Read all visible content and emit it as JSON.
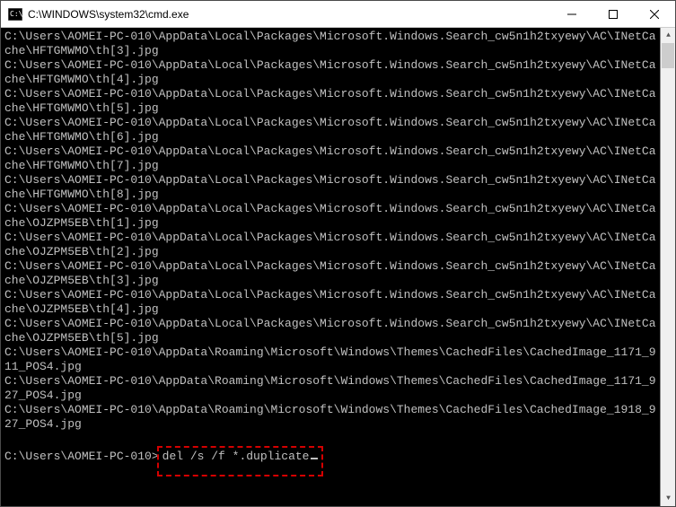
{
  "window": {
    "title": "C:\\WINDOWS\\system32\\cmd.exe"
  },
  "terminal": {
    "lines": [
      "C:\\Users\\AOMEI-PC-010\\AppData\\Local\\Packages\\Microsoft.Windows.Search_cw5n1h2txyewy\\AC\\INetCache\\HFTGMWMO\\th[3].jpg",
      "C:\\Users\\AOMEI-PC-010\\AppData\\Local\\Packages\\Microsoft.Windows.Search_cw5n1h2txyewy\\AC\\INetCache\\HFTGMWMO\\th[4].jpg",
      "C:\\Users\\AOMEI-PC-010\\AppData\\Local\\Packages\\Microsoft.Windows.Search_cw5n1h2txyewy\\AC\\INetCache\\HFTGMWMO\\th[5].jpg",
      "C:\\Users\\AOMEI-PC-010\\AppData\\Local\\Packages\\Microsoft.Windows.Search_cw5n1h2txyewy\\AC\\INetCache\\HFTGMWMO\\th[6].jpg",
      "C:\\Users\\AOMEI-PC-010\\AppData\\Local\\Packages\\Microsoft.Windows.Search_cw5n1h2txyewy\\AC\\INetCache\\HFTGMWMO\\th[7].jpg",
      "C:\\Users\\AOMEI-PC-010\\AppData\\Local\\Packages\\Microsoft.Windows.Search_cw5n1h2txyewy\\AC\\INetCache\\HFTGMWMO\\th[8].jpg",
      "C:\\Users\\AOMEI-PC-010\\AppData\\Local\\Packages\\Microsoft.Windows.Search_cw5n1h2txyewy\\AC\\INetCache\\OJZPM5EB\\th[1].jpg",
      "C:\\Users\\AOMEI-PC-010\\AppData\\Local\\Packages\\Microsoft.Windows.Search_cw5n1h2txyewy\\AC\\INetCache\\OJZPM5EB\\th[2].jpg",
      "C:\\Users\\AOMEI-PC-010\\AppData\\Local\\Packages\\Microsoft.Windows.Search_cw5n1h2txyewy\\AC\\INetCache\\OJZPM5EB\\th[3].jpg",
      "C:\\Users\\AOMEI-PC-010\\AppData\\Local\\Packages\\Microsoft.Windows.Search_cw5n1h2txyewy\\AC\\INetCache\\OJZPM5EB\\th[4].jpg",
      "C:\\Users\\AOMEI-PC-010\\AppData\\Local\\Packages\\Microsoft.Windows.Search_cw5n1h2txyewy\\AC\\INetCache\\OJZPM5EB\\th[5].jpg",
      "C:\\Users\\AOMEI-PC-010\\AppData\\Roaming\\Microsoft\\Windows\\Themes\\CachedFiles\\CachedImage_1171_911_POS4.jpg",
      "C:\\Users\\AOMEI-PC-010\\AppData\\Roaming\\Microsoft\\Windows\\Themes\\CachedFiles\\CachedImage_1171_927_POS4.jpg",
      "C:\\Users\\AOMEI-PC-010\\AppData\\Roaming\\Microsoft\\Windows\\Themes\\CachedFiles\\CachedImage_1918_927_POS4.jpg"
    ],
    "prompt": "C:\\Users\\AOMEI-PC-010>",
    "command": "del /s /f *.duplicate"
  }
}
